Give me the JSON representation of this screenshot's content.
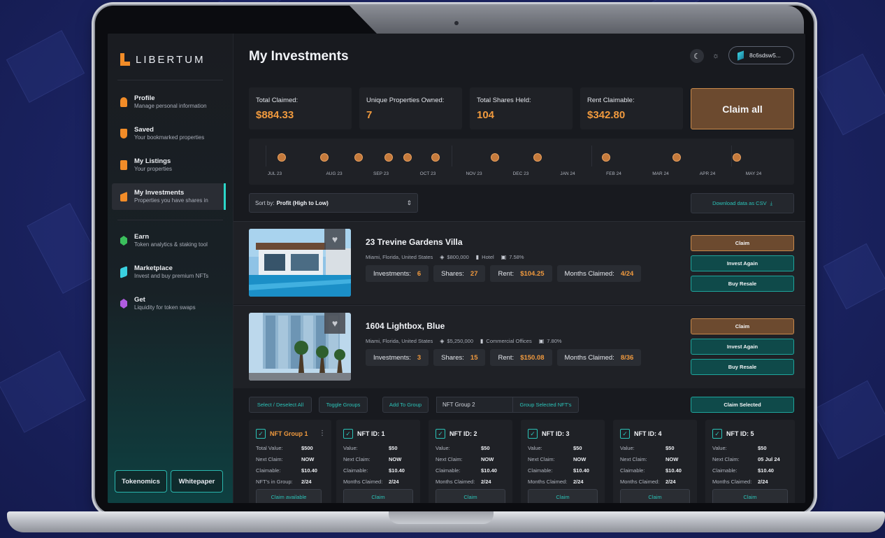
{
  "app": {
    "name": "LIBERTUM"
  },
  "sidebar": {
    "items": [
      {
        "title": "Profile",
        "subtitle": "Manage personal information",
        "icon": "person-icon",
        "color": "#f28c28"
      },
      {
        "title": "Saved",
        "subtitle": "Your bookmarked properties",
        "icon": "shield-icon",
        "color": "#f28c28"
      },
      {
        "title": "My Listings",
        "subtitle": "Your properties",
        "icon": "listing-icon",
        "color": "#f28c28"
      },
      {
        "title": "My Investments",
        "subtitle": "Properties you have shares in",
        "icon": "investments-icon",
        "color": "#f28c28"
      },
      {
        "title": "Earn",
        "subtitle": "Token analytics & staking tool",
        "icon": "earn-icon",
        "color": "#3bbf5c"
      },
      {
        "title": "Marketplace",
        "subtitle": "Invest and buy premium NFTs",
        "icon": "marketplace-icon",
        "color": "#3ad1e0"
      },
      {
        "title": "Get",
        "subtitle": "Liquidity for token swaps",
        "icon": "get-icon",
        "color": "#b05ce0"
      }
    ],
    "tokenomics_label": "Tokenomics",
    "whitepaper_label": "Whitepaper"
  },
  "header": {
    "title": "My Investments",
    "wallet": "8c6sdsw5..."
  },
  "stats": [
    {
      "label": "Total Claimed:",
      "value": "$884.33"
    },
    {
      "label": "Unique Properties Owned:",
      "value": "7"
    },
    {
      "label": "Total Shares Held:",
      "value": "104"
    },
    {
      "label": "Rent Claimable:",
      "value": "$342.80"
    }
  ],
  "claim_all_label": "Claim all",
  "timeline": {
    "months": [
      "JUL 23",
      "AUG 23",
      "SEP 23",
      "OCT 23",
      "NOV 23",
      "DEC 23",
      "JAN 24",
      "FEB 24",
      "MAR 24",
      "APR 24",
      "MAY 24"
    ]
  },
  "sort": {
    "label": "Sort by:",
    "value": "Profit (High to Low)"
  },
  "download_label": "Download data as CSV",
  "properties": [
    {
      "name": "23 Trevine Gardens Villa",
      "location": "Miami, Florida, United States",
      "price": "$800,000",
      "type": "Hotel",
      "yield": "7.58%",
      "investments": "6",
      "shares": "27",
      "rent": "$104.25",
      "months_claimed": "4/24"
    },
    {
      "name": "1604 Lightbox, Blue",
      "location": "Miami, Florida, United States",
      "price": "$5,250,000",
      "type": "Commercial Offices",
      "yield": "7.80%",
      "investments": "3",
      "shares": "15",
      "rent": "$150.08",
      "months_claimed": "8/36"
    }
  ],
  "labels": {
    "investments": "Investments:",
    "shares": "Shares:",
    "rent": "Rent:",
    "months_claimed": "Months Claimed:",
    "claim": "Claim",
    "invest_again": "Invest Again",
    "buy_resale": "Buy Resale"
  },
  "toolbar": {
    "select_all": "Select / Deselect All",
    "toggle_groups": "Toggle Groups",
    "add_to_group": "Add To Group",
    "group_name": "NFT Group 2",
    "group_selected": "Group Selected NFT's",
    "claim_selected": "Claim Selected"
  },
  "nft_cards": [
    {
      "title": "NFT Group 1",
      "rows": [
        [
          "Total Value:",
          "$500"
        ],
        [
          "Next Claim:",
          "NOW"
        ],
        [
          "Claimable:",
          "$10.40"
        ],
        [
          "NFT's in Group:",
          "2/24"
        ]
      ],
      "button": "Claim available"
    },
    {
      "title": "NFT ID: 1",
      "rows": [
        [
          "Value:",
          "$50"
        ],
        [
          "Next Claim:",
          "NOW"
        ],
        [
          "Claimable:",
          "$10.40"
        ],
        [
          "Months Claimed:",
          "2/24"
        ]
      ],
      "button": "Claim"
    },
    {
      "title": "NFT ID: 2",
      "rows": [
        [
          "Value:",
          "$50"
        ],
        [
          "Next Claim:",
          "NOW"
        ],
        [
          "Claimable:",
          "$10.40"
        ],
        [
          "Months Claimed:",
          "2/24"
        ]
      ],
      "button": "Claim"
    },
    {
      "title": "NFT ID: 3",
      "rows": [
        [
          "Value:",
          "$50"
        ],
        [
          "Next Claim:",
          "NOW"
        ],
        [
          "Claimable:",
          "$10.40"
        ],
        [
          "Months Claimed:",
          "2/24"
        ]
      ],
      "button": "Claim"
    },
    {
      "title": "NFT ID: 4",
      "rows": [
        [
          "Value:",
          "$50"
        ],
        [
          "Next Claim:",
          "NOW"
        ],
        [
          "Claimable:",
          "$10.40"
        ],
        [
          "Months Claimed:",
          "2/24"
        ]
      ],
      "button": "Claim"
    },
    {
      "title": "NFT ID: 5",
      "rows": [
        [
          "Value:",
          "$50"
        ],
        [
          "Next Claim:",
          "05 Jul 24"
        ],
        [
          "Claimable:",
          "$10.40"
        ],
        [
          "Months Claimed:",
          "2/24"
        ]
      ],
      "button": "Claim"
    }
  ],
  "colors": {
    "accent_orange": "#f19a3e",
    "accent_teal": "#2bc3b8",
    "claim_brown": "#6c4a2f"
  }
}
